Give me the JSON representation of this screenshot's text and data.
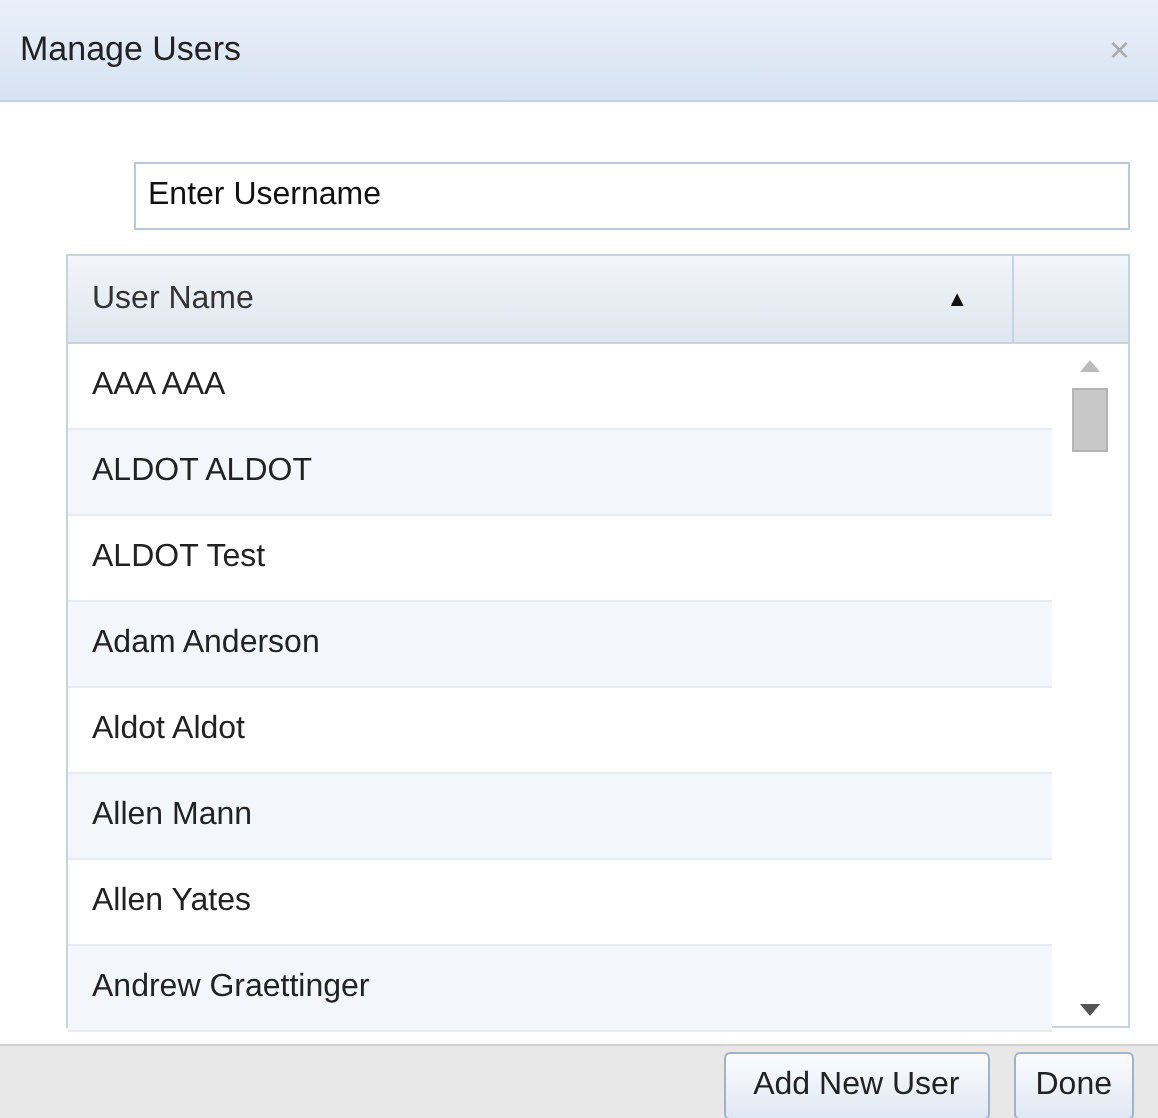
{
  "window": {
    "title": "Manage Users",
    "close": "×"
  },
  "search": {
    "value": "Enter Username"
  },
  "table": {
    "columns": [
      {
        "label": "User Name",
        "sort": "▲"
      }
    ],
    "rows": [
      {
        "name": "AAA AAA"
      },
      {
        "name": "ALDOT ALDOT"
      },
      {
        "name": "ALDOT Test"
      },
      {
        "name": "Adam Anderson"
      },
      {
        "name": "Aldot Aldot"
      },
      {
        "name": "Allen Mann"
      },
      {
        "name": "Allen Yates"
      },
      {
        "name": "Andrew Graettinger"
      }
    ]
  },
  "buttons": [
    {
      "label": "Add New User"
    },
    {
      "label": "Done"
    }
  ]
}
